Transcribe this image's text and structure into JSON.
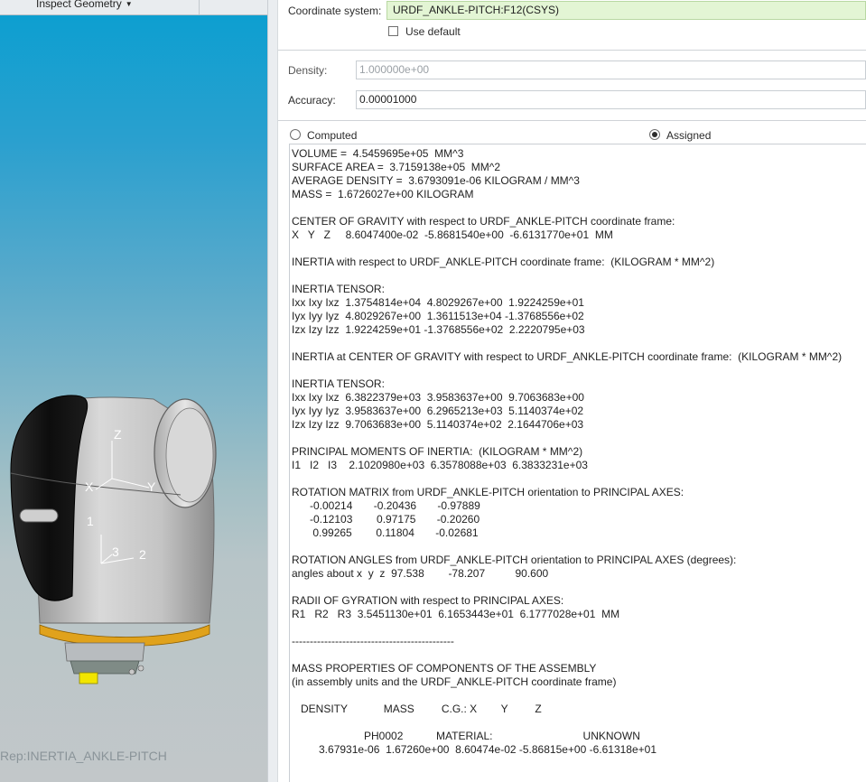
{
  "viewport": {
    "toolbar_label": "Inspect Geometry",
    "rep_label": "Rep:INERTIA_ANKLE-PITCH",
    "model_axes": {
      "x": "X",
      "y": "Y",
      "z": "Z",
      "p1": "1",
      "p2": "2",
      "p3": "3"
    },
    "colors": {
      "bg_top": "#0a9fd0",
      "bg_bottom": "#c2c7c9",
      "shell": "#c9c9c9",
      "cover": "#111111",
      "ring": "#e0a21c",
      "connector": "#f2e500"
    }
  },
  "panel": {
    "coordinate_system_label": "Coordinate system:",
    "coordinate_system_value": "URDF_ANKLE-PITCH:F12(CSYS)",
    "use_default_label": "Use default",
    "use_default_checked": false,
    "density_label": "Density:",
    "density_value": "1.000000e+00",
    "accuracy_label": "Accuracy:",
    "accuracy_value": "0.00001000",
    "computed_label": "Computed",
    "assigned_label": "Assigned",
    "selected_mode": "Assigned"
  },
  "report_lines": [
    "VOLUME =  4.5459695e+05  MM^3",
    "SURFACE AREA =  3.7159138e+05  MM^2",
    "AVERAGE DENSITY =  3.6793091e-06 KILOGRAM / MM^3",
    "MASS =  1.6726027e+00 KILOGRAM",
    "",
    "CENTER OF GRAVITY with respect to URDF_ANKLE-PITCH coordinate frame:",
    "X   Y   Z     8.6047400e-02  -5.8681540e+00  -6.6131770e+01  MM",
    "",
    "INERTIA with respect to URDF_ANKLE-PITCH coordinate frame:  (KILOGRAM * MM^2)",
    "",
    "INERTIA TENSOR:",
    "Ixx Ixy Ixz  1.3754814e+04  4.8029267e+00  1.9224259e+01",
    "Iyx Iyy Iyz  4.8029267e+00  1.3611513e+04 -1.3768556e+02",
    "Izx Izy Izz  1.9224259e+01 -1.3768556e+02  2.2220795e+03",
    "",
    "INERTIA at CENTER OF GRAVITY with respect to URDF_ANKLE-PITCH coordinate frame:  (KILOGRAM * MM^2)",
    "",
    "INERTIA TENSOR:",
    "Ixx Ixy Ixz  6.3822379e+03  3.9583637e+00  9.7063683e+00",
    "Iyx Iyy Iyz  3.9583637e+00  6.2965213e+03  5.1140374e+02",
    "Izx Izy Izz  9.7063683e+00  5.1140374e+02  2.1644706e+03",
    "",
    "PRINCIPAL MOMENTS OF INERTIA:  (KILOGRAM * MM^2)",
    "I1   I2   I3    2.1020980e+03  6.3578088e+03  6.3833231e+03",
    "",
    "ROTATION MATRIX from URDF_ANKLE-PITCH orientation to PRINCIPAL AXES:",
    "      -0.00214       -0.20436       -0.97889",
    "      -0.12103        0.97175       -0.20260",
    "       0.99265        0.11804       -0.02681",
    "",
    "ROTATION ANGLES from URDF_ANKLE-PITCH orientation to PRINCIPAL AXES (degrees):",
    "angles about x  y  z  97.538        -78.207          90.600",
    "",
    "RADII OF GYRATION with respect to PRINCIPAL AXES:",
    "R1   R2   R3  3.5451130e+01  6.1653443e+01  6.1777028e+01  MM",
    "",
    "---------------------------------------------",
    "",
    "MASS PROPERTIES OF COMPONENTS OF THE ASSEMBLY",
    "(in assembly units and the URDF_ANKLE-PITCH coordinate frame)",
    "",
    "   DENSITY            MASS         C.G.: X        Y         Z",
    "",
    "                        PH0002           MATERIAL:                              UNKNOWN",
    "         3.67931e-06  1.67260e+00  8.60474e-02 -5.86815e+00 -6.61318e+01"
  ]
}
